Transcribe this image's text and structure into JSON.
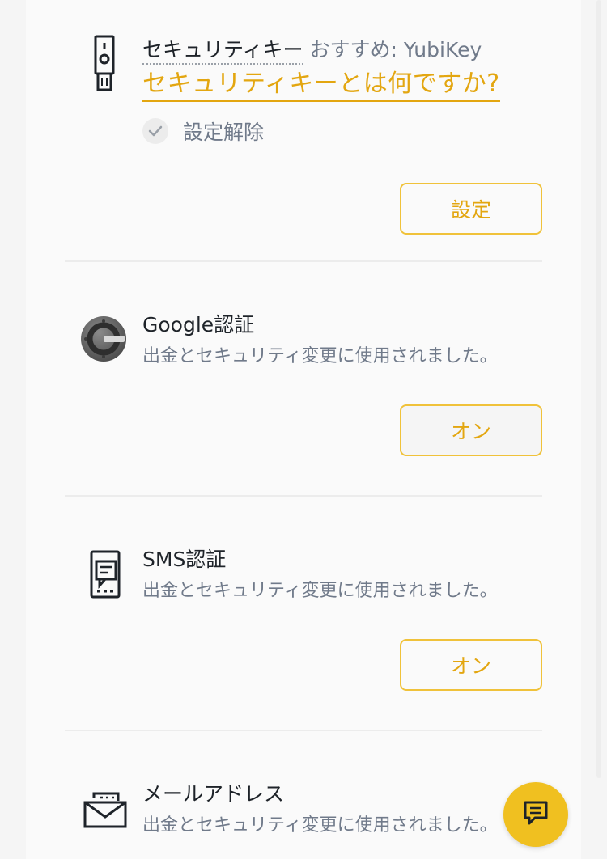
{
  "security_key": {
    "title": "セキュリティキー",
    "recommendation": "おすすめ: YubiKey",
    "help_link": "セキュリティキーとは何ですか?",
    "status_label": "設定解除",
    "button_label": "設定"
  },
  "google_auth": {
    "title": "Google認証",
    "description": "出金とセキュリティ変更に使用されました。",
    "button_label": "オン"
  },
  "sms_auth": {
    "title": "SMS認証",
    "description": "出金とセキュリティ変更に使用されました。",
    "button_label": "オン"
  },
  "email": {
    "title": "メールアドレス",
    "description": "出金とセキュリティ変更に使用されました。"
  },
  "icons": {
    "security_key": "usb-key-icon",
    "google": "google-authenticator-icon",
    "sms": "phone-message-icon",
    "email": "envelope-icon",
    "check": "check-icon",
    "chat": "chat-icon"
  },
  "colors": {
    "accent": "#f0c23a",
    "accent_text": "#e3a610",
    "text_primary": "#1e2329",
    "text_secondary": "#707a8a",
    "chat_button": "#f0c020"
  }
}
